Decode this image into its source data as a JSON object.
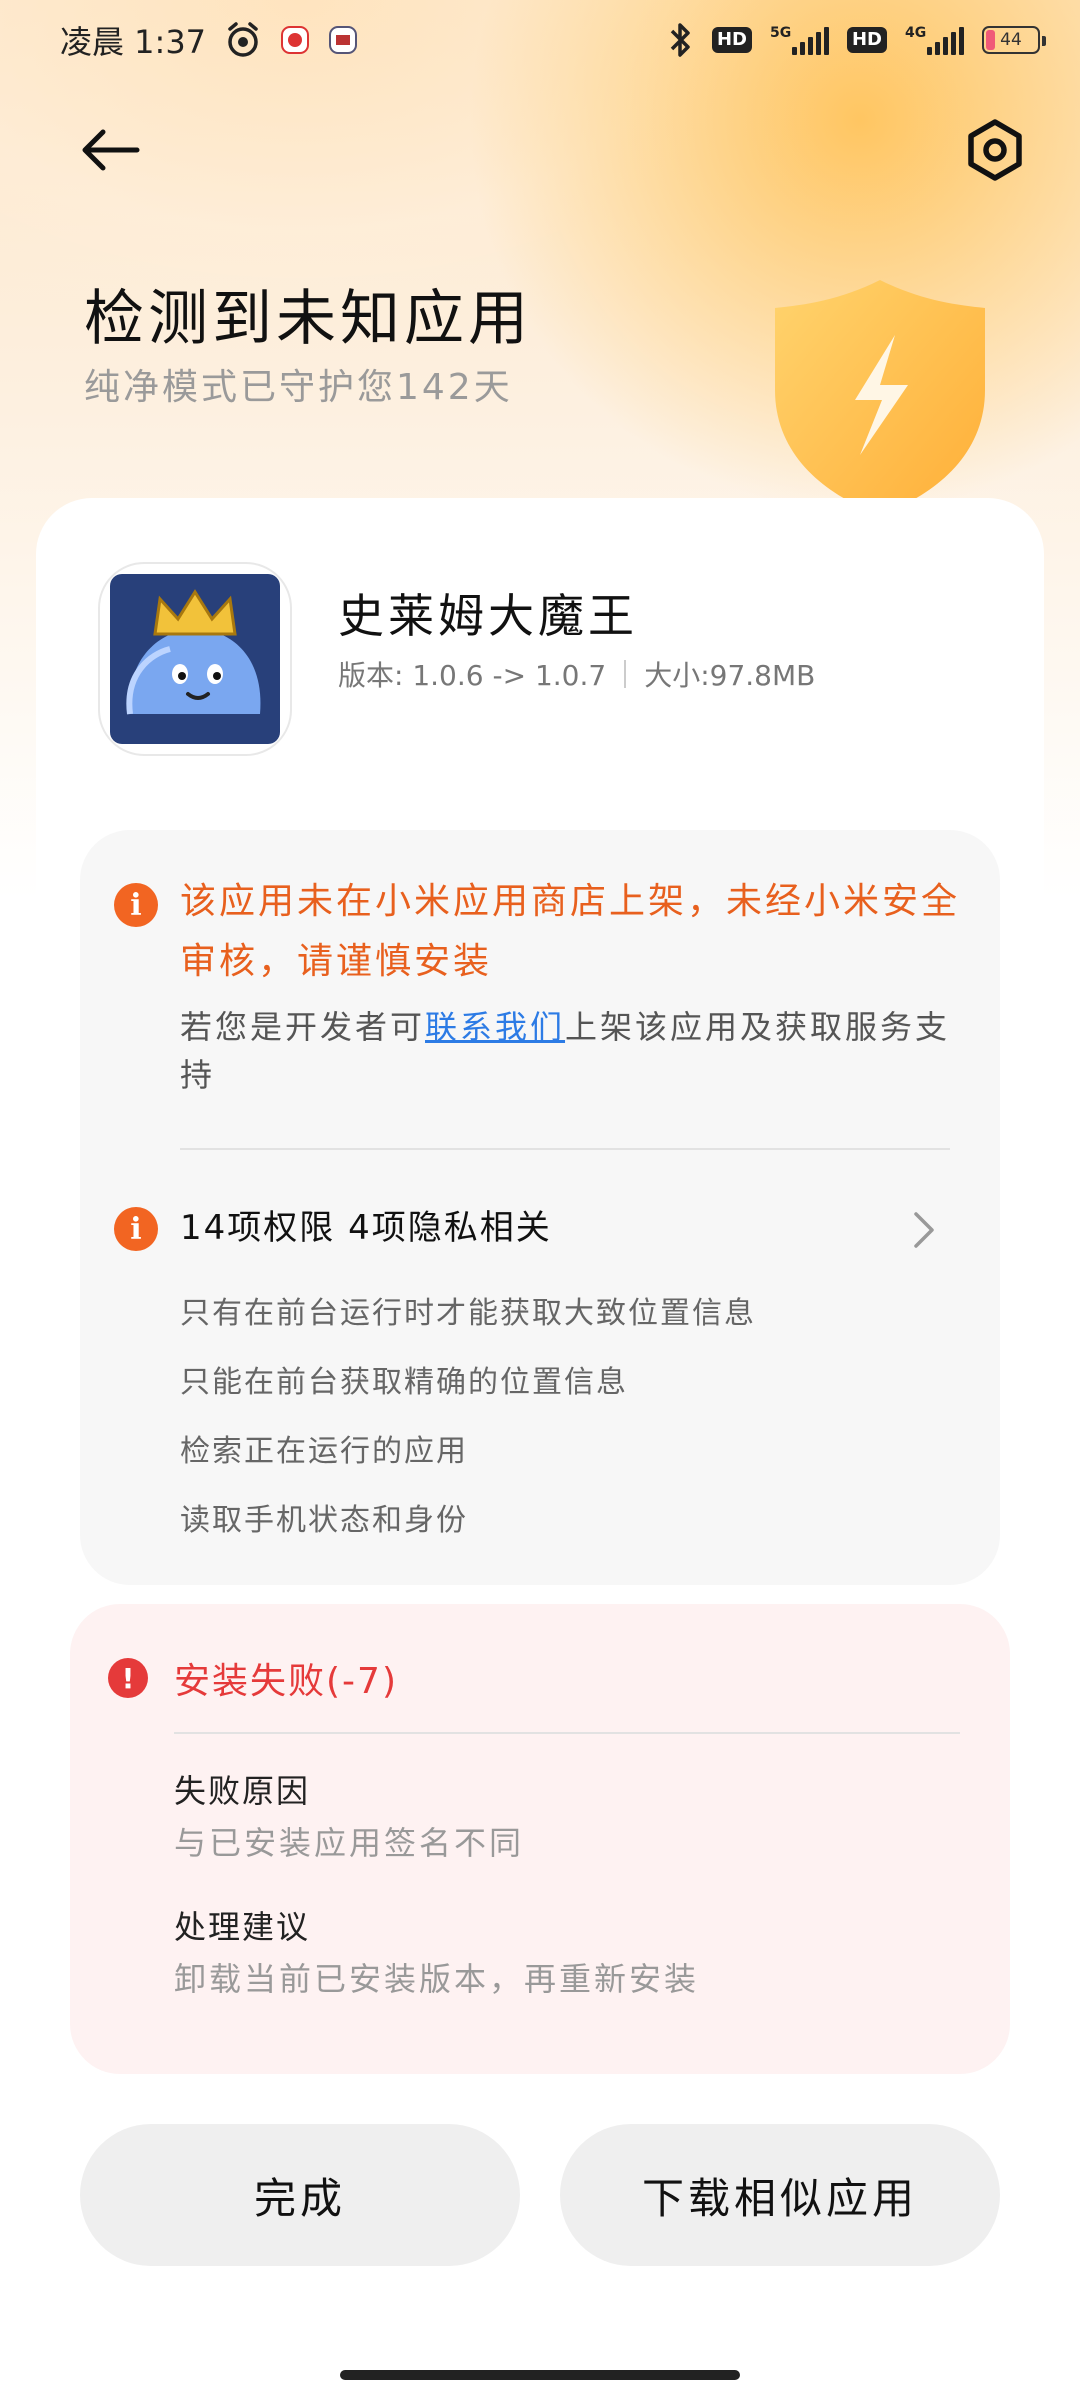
{
  "status_bar": {
    "time": "凌晨 1:37",
    "signal1_label": "5G",
    "signal2_label": "4G",
    "hd1": "HD",
    "hd2": "HD",
    "battery": "44",
    "icons": [
      "alarm-icon",
      "app-notification-icon",
      "app-notification-icon",
      "bluetooth-icon",
      "signal-icon",
      "battery-icon"
    ]
  },
  "header": {
    "title": "检测到未知应用",
    "subtitle": "纯净模式已守护您142天"
  },
  "app": {
    "name": "史莱姆大魔王",
    "version": "版本: 1.0.6 -> 1.0.7",
    "size": "大小:97.8MB"
  },
  "warning": {
    "title": "该应用未在小米应用商店上架，未经小米安全审核，请谨慎安装",
    "desc_before": "若您是开发者可",
    "desc_link": "联系我们",
    "desc_after": "上架该应用及获取服务支持"
  },
  "permissions": {
    "title": "14项权限 4项隐私相关",
    "items": [
      "只有在前台运行时才能获取大致位置信息",
      "只能在前台获取精确的位置信息",
      "检索正在运行的应用",
      "读取手机状态和身份"
    ]
  },
  "failure": {
    "title": "安装失败(-7)",
    "reason_label": "失败原因",
    "reason_value": "与已安装应用签名不同",
    "suggestion_label": "处理建议",
    "suggestion_value": "卸载当前已安装版本，再重新安装"
  },
  "buttons": {
    "done": "完成",
    "download_similar": "下载相似应用"
  },
  "colors": {
    "warning_orange": "#f26522",
    "error_red": "#e53a3a",
    "link_blue": "#2c7be5",
    "shield_gold": "#ffc247"
  }
}
